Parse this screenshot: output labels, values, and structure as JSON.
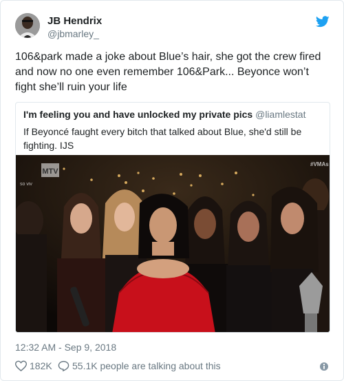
{
  "author": {
    "name": "JB Hendrix",
    "handle": "@jbmarley_"
  },
  "tweet": {
    "text": "106&park made a joke about Blue’s hair,  she got the crew fired and  now no one even remember 106&Park... Beyonce won’t fight she’ll ruin your life"
  },
  "quoted": {
    "name": "I'm feeling you and have unlocked my private pics",
    "handle": "@liamlestat",
    "text": "If Beyoncé faught every bitch that talked about Blue, she'd still be fighting. IJS",
    "photo_overlay": {
      "logo": "MTV",
      "left_text": "so viv",
      "right_text": "#VMAs"
    }
  },
  "meta": {
    "timestamp": "12:32 AM - Sep 9, 2018",
    "likes": "182K",
    "talking": "55.1K people are talking about this"
  },
  "icons": {
    "brand": "twitter-bird-icon",
    "like": "heart-icon",
    "reply": "speech-bubble-icon",
    "info": "info-icon"
  },
  "colors": {
    "brand_blue": "#1da1f2",
    "secondary_text": "#697882",
    "dress_red": "#c8101b"
  }
}
